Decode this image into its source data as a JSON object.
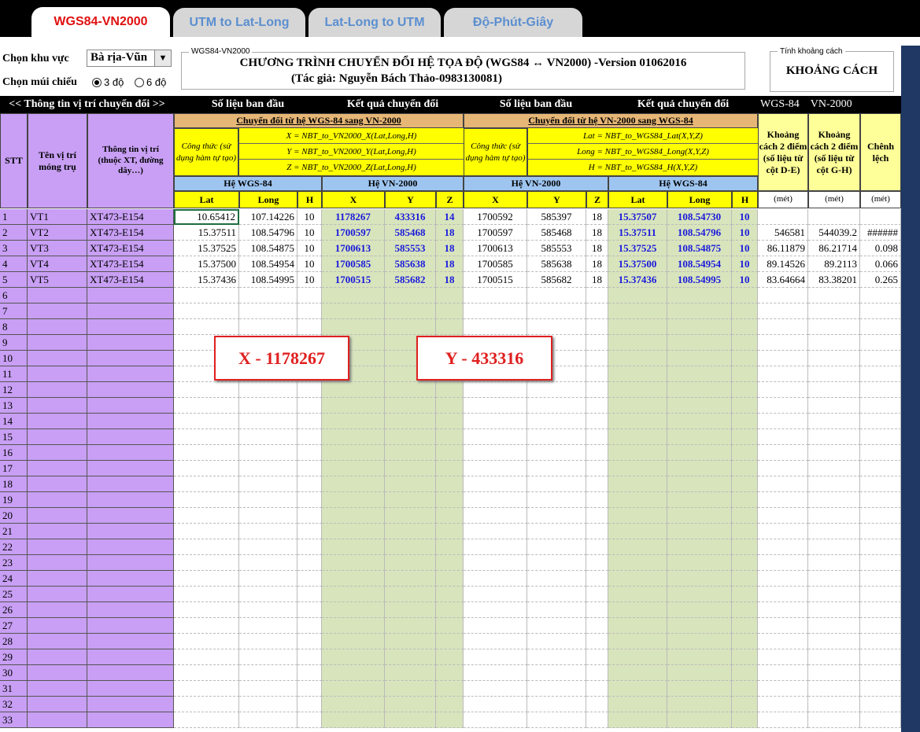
{
  "tabs": [
    {
      "label": "WGS84-VN2000",
      "active": true
    },
    {
      "label": "UTM to Lat-Long",
      "active": false
    },
    {
      "label": "Lat-Long to UTM",
      "active": false
    },
    {
      "label": "Độ-Phút-Giây",
      "active": false
    }
  ],
  "controls": {
    "region_label": "Chọn khu vực",
    "region_value": "Bà rịa-Vũn",
    "zone_label": "Chọn múi chiếu",
    "zone_options": [
      "3 độ",
      "6 độ"
    ],
    "zone_selected": "3 độ"
  },
  "program_box": {
    "group_label": "WGS84-VN2000",
    "title": "CHƯƠNG TRÌNH CHUYỂN ĐỔI HỆ TỌA ĐỘ (WGS84 ↔ VN2000) -Version 01062016",
    "author": "(Tác giả: Nguyễn Bách Thảo-0983130081)"
  },
  "distance_box": {
    "group_label": "Tính khoảng cách",
    "button_label": "KHOẢNG CÁCH"
  },
  "black_row": {
    "info": "<< Thông tin vị trí chuyển đổi >>",
    "orig1": "Số liệu ban đầu",
    "result1": "Kết quả chuyển đổi",
    "orig2": "Số liệu ban đầu",
    "result2": "Kết quả chuyển đổi",
    "wgs": "WGS-84",
    "vn": "VN-2000"
  },
  "headers": {
    "stt": "STT",
    "name": "Tên vị trí móng trụ",
    "info": "Thông tin vị trí (thuộc XT, đường dây…)",
    "sec1_title": "Chuyển đổi từ hệ WGS-84 sang VN-2000",
    "sec2_title": "Chuyển đổi từ hệ VN-2000 sang WGS-84",
    "formula_note": "Công thức (sử dụng hàm tự tạo)",
    "sec1_formulas": [
      "X = NBT_to_VN2000_X(Lat,Long,H)",
      "Y = NBT_to_VN2000_Y(Lat,Long,H)",
      "Z = NBT_to_VN2000_Z(Lat,Long,H)"
    ],
    "sec2_formulas": [
      "Lat = NBT_to_WGS84_Lat(X,Y,Z)",
      "Long = NBT_to_WGS84_Long(X,Y,Z)",
      "H = NBT_to_WGS84_H(X,Y,Z)"
    ],
    "he_wgs": "Hệ WGS-84",
    "he_vn": "Hệ VN-2000",
    "lat": "Lat",
    "long": "Long",
    "h": "H",
    "x": "X",
    "y": "Y",
    "z": "Z",
    "dist1": "Khoảng cách 2 điểm (số liệu từ cột D-E)",
    "dist2": "Khoảng cách 2 điểm (số liệu từ cột G-H)",
    "diff": "Chênh lệch",
    "unit": "(mét)"
  },
  "rows": [
    {
      "stt": "1",
      "name": "VT1",
      "info": "XT473-E154",
      "lat": "10.65412",
      "long": "107.14226",
      "h": "10",
      "x": "1178267",
      "y": "433316",
      "z": "14",
      "x2": "1700592",
      "y2": "585397",
      "z2": "18",
      "lat2": "15.37507",
      "long2": "108.54730",
      "h2": "10",
      "d1": "",
      "d2": "",
      "diff": ""
    },
    {
      "stt": "2",
      "name": "VT2",
      "info": "XT473-E154",
      "lat": "15.37511",
      "long": "108.54796",
      "h": "10",
      "x": "1700597",
      "y": "585468",
      "z": "18",
      "x2": "1700597",
      "y2": "585468",
      "z2": "18",
      "lat2": "15.37511",
      "long2": "108.54796",
      "h2": "10",
      "d1": "546581",
      "d2": "544039.2",
      "diff": "######"
    },
    {
      "stt": "3",
      "name": "VT3",
      "info": "XT473-E154",
      "lat": "15.37525",
      "long": "108.54875",
      "h": "10",
      "x": "1700613",
      "y": "585553",
      "z": "18",
      "x2": "1700613",
      "y2": "585553",
      "z2": "18",
      "lat2": "15.37525",
      "long2": "108.54875",
      "h2": "10",
      "d1": "86.11879",
      "d2": "86.21714",
      "diff": "0.098"
    },
    {
      "stt": "4",
      "name": "VT4",
      "info": "XT473-E154",
      "lat": "15.37500",
      "long": "108.54954",
      "h": "10",
      "x": "1700585",
      "y": "585638",
      "z": "18",
      "x2": "1700585",
      "y2": "585638",
      "z2": "18",
      "lat2": "15.37500",
      "long2": "108.54954",
      "h2": "10",
      "d1": "89.14526",
      "d2": "89.2113",
      "diff": "0.066"
    },
    {
      "stt": "5",
      "name": "VT5",
      "info": "XT473-E154",
      "lat": "15.37436",
      "long": "108.54995",
      "h": "10",
      "x": "1700515",
      "y": "585682",
      "z": "18",
      "x2": "1700515",
      "y2": "585682",
      "z2": "18",
      "lat2": "15.37436",
      "long2": "108.54995",
      "h2": "10",
      "d1": "83.64664",
      "d2": "83.38201",
      "diff": "0.265"
    }
  ],
  "empty_row_numbers": [
    "6",
    "7",
    "8",
    "9",
    "10",
    "11",
    "12",
    "13",
    "14",
    "15",
    "16",
    "17",
    "18",
    "19",
    "20",
    "21",
    "22",
    "23",
    "24",
    "25",
    "26",
    "27",
    "28",
    "29",
    "30",
    "31",
    "32",
    "33"
  ],
  "overlays": {
    "x_box": "X - 1178267",
    "y_box": "Y - 433316"
  },
  "colors": {
    "purple": "#c89ff4",
    "yellow": "#ffff00",
    "light_yellow": "#ffff99",
    "tan": "#e6b676",
    "blue": "#9ec5f0",
    "green": "#d8e4bc",
    "result_text": "#1a1adb",
    "overlay_red": "#e02020",
    "right_bar": "#1f3864"
  }
}
